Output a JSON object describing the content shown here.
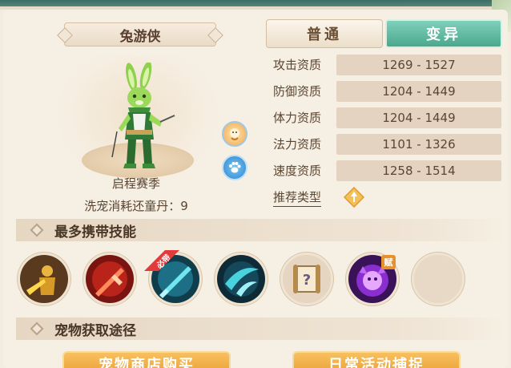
{
  "pet": {
    "name": "兔游侠",
    "season": "启程赛季",
    "wash_cost_label": "洗宠消耗还童丹：",
    "wash_cost_value": "9"
  },
  "tabs": [
    {
      "label": "普通",
      "active": false
    },
    {
      "label": "变异",
      "active": true
    }
  ],
  "stats": [
    {
      "label": "攻击资质",
      "range": "1269 - 1527"
    },
    {
      "label": "防御资质",
      "range": "1204 - 1449"
    },
    {
      "label": "体力资质",
      "range": "1204 - 1449"
    },
    {
      "label": "法力资质",
      "range": "1101 - 1326"
    },
    {
      "label": "速度资质",
      "range": "1258 - 1514"
    }
  ],
  "recommend_label": "推荐类型",
  "sections": {
    "skills_title": "最多携带技能",
    "acquire_title": "宠物获取途径"
  },
  "skills": [
    {
      "icon": "golden-warrior-icon"
    },
    {
      "icon": "red-sword-icon",
      "badge": ""
    },
    {
      "icon": "ice-sword-icon",
      "badge": "必带"
    },
    {
      "icon": "cyan-slash-icon"
    },
    {
      "icon": "mystery-scroll-icon"
    },
    {
      "icon": "purple-spirit-icon",
      "badge": "赋"
    },
    {
      "icon": "empty-slot-icon"
    }
  ],
  "acquire_buttons": [
    {
      "label": "宠物商店购买"
    },
    {
      "label": "日常活动捕捉"
    }
  ],
  "colors": {
    "mutant_tab": "#4aa88d",
    "value_bg": "#e4d3c0",
    "button_orange": "#e89a2c"
  }
}
